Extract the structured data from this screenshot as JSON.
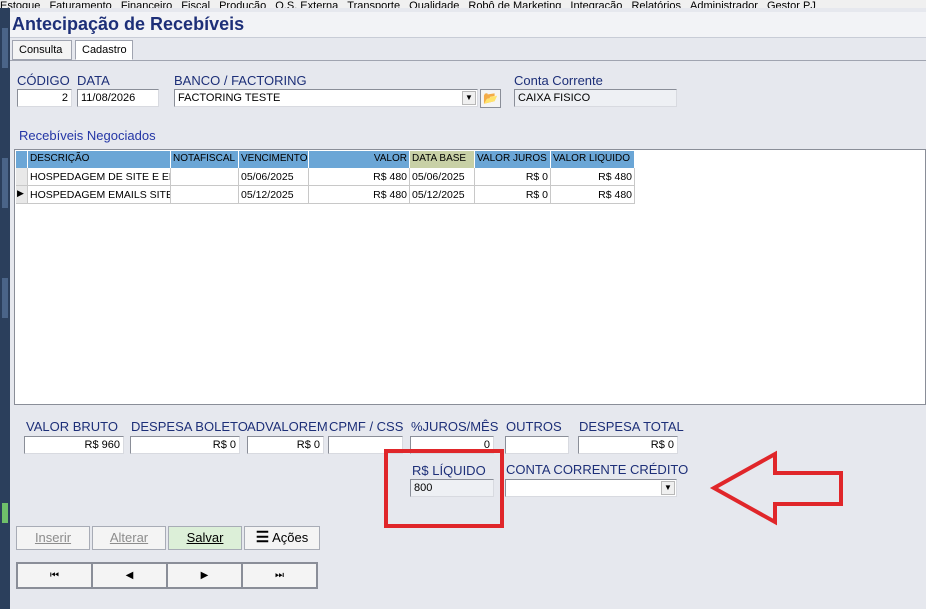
{
  "menu": [
    "Estoque",
    "Faturamento",
    "Financeiro",
    "Fiscal",
    "Produção",
    "O.S. Externa",
    "Transporte",
    "Qualidade",
    "Robô de Marketing",
    "Integração",
    "Relatórios",
    "Administrador",
    "Gestor PJ"
  ],
  "window_title": "Antecipação de Recebíveis",
  "tabs": [
    "Consulta",
    "Cadastro"
  ],
  "labels": {
    "codigo": "CÓDIGO",
    "data": "DATA",
    "banco": "BANCO / FACTORING",
    "conta_corrente": "Conta Corrente",
    "recebiveis": "Recebíveis Negociados",
    "valor_bruto": "VALOR BRUTO",
    "despesa_boleto": "DESPESA BOLETO",
    "advalorem": "ADVALOREM",
    "cpmf": "CPMF / CSS",
    "juros": "%JUROS/MÊS",
    "outros": "OUTROS",
    "despesa_total": "DESPESA TOTAL",
    "liquido": "R$ LÍQUIDO",
    "conta_credito": "CONTA CORRENTE CRÉDITO"
  },
  "values": {
    "codigo": "2",
    "data": "11/08/2026",
    "banco": "FACTORING TESTE",
    "conta_corrente": "CAIXA FISICO",
    "valor_bruto": "R$ 960",
    "despesa_boleto": "R$ 0",
    "advalorem": "R$ 0",
    "cpmf": "",
    "juros": "0",
    "outros": "",
    "despesa_total": "R$ 0",
    "liquido": "800",
    "conta_credito": ""
  },
  "grid": {
    "headers": [
      "DESCRIÇÃO",
      "NOTAFISCAL",
      "VENCIMENTO",
      "VALOR",
      "DATA BASE",
      "VALOR JUROS",
      "VALOR LIQUIDO"
    ],
    "rows": [
      [
        "HOSPEDAGEM DE SITE E EMA",
        "",
        "05/06/2025",
        "R$ 480",
        "05/06/2025",
        "R$ 0",
        "R$ 480"
      ],
      [
        "HOSPEDAGEM EMAILS SITE C",
        "",
        "05/12/2025",
        "R$ 480",
        "05/12/2025",
        "R$ 0",
        "R$ 480"
      ]
    ]
  },
  "buttons": {
    "inserir": "Inserir",
    "alterar": "Alterar",
    "salvar": "Salvar",
    "acoes": "Ações"
  },
  "nav": {
    "first": "⏮",
    "prev": "◀",
    "next": "▶",
    "last": "⏭"
  },
  "colors": {
    "title": "#1d2f78",
    "grid_header": "#6ba6d6",
    "highlight": "#e0262a"
  }
}
